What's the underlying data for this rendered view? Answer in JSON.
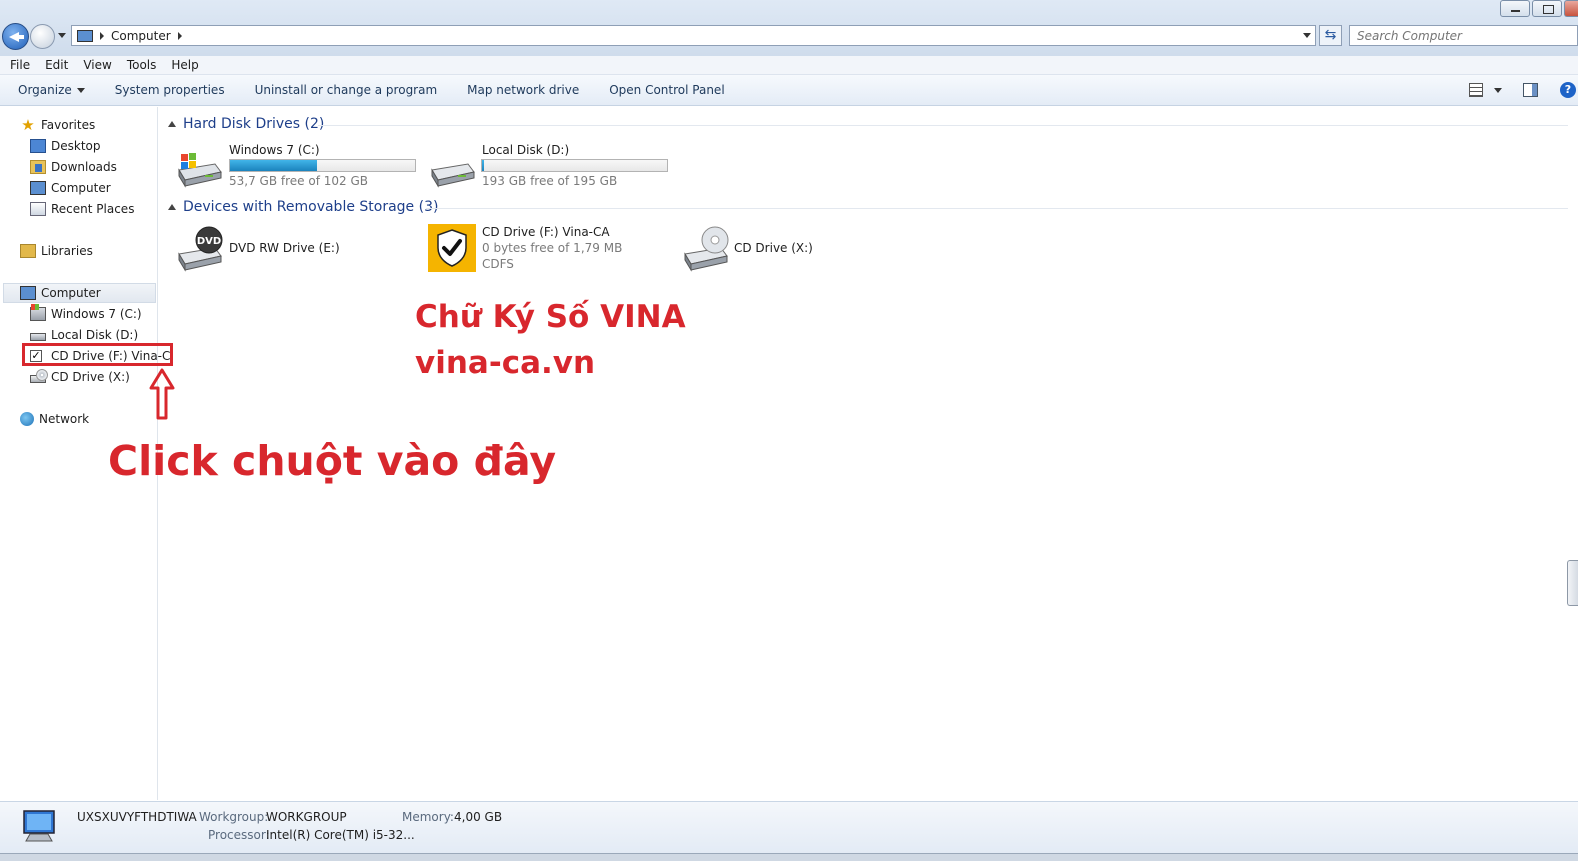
{
  "address": {
    "crumb": "Computer",
    "search_placeholder": "Search Computer"
  },
  "menu": [
    "File",
    "Edit",
    "View",
    "Tools",
    "Help"
  ],
  "commands": {
    "organize": "Organize",
    "system_properties": "System properties",
    "uninstall": "Uninstall or change a program",
    "map_drive": "Map network drive",
    "control_panel": "Open Control Panel"
  },
  "nav": {
    "favorites": "Favorites",
    "desktop": "Desktop",
    "downloads": "Downloads",
    "computer_fav": "Computer",
    "recent": "Recent Places",
    "libraries": "Libraries",
    "computer": "Computer",
    "win_c": "Windows 7 (C:)",
    "local_d": "Local Disk (D:)",
    "cd_f": "CD Drive (F:) Vina-C",
    "cd_x": "CD Drive (X:)",
    "network": "Network"
  },
  "groups": {
    "hdd": "Hard Disk Drives (2)",
    "removable": "Devices with Removable Storage (3)"
  },
  "drives": {
    "c": {
      "name": "Windows 7 (C:)",
      "free": "53,7 GB free of 102 GB",
      "used_fraction": 0.47
    },
    "d": {
      "name": "Local Disk (D:)",
      "free": "193 GB free of 195 GB",
      "used_fraction": 0.01
    },
    "e": {
      "name": "DVD RW Drive (E:)"
    },
    "f": {
      "name": "CD Drive (F:) Vina-CA",
      "free": "0 bytes free of 1,79 MB",
      "fs": "CDFS"
    },
    "x": {
      "name": "CD Drive (X:)"
    }
  },
  "overlay": {
    "brand": "Chữ Ký Số VINA",
    "site": "vina-ca.vn",
    "instruction": "Click chuột vào đây"
  },
  "details": {
    "computer_name": "UXSXUVYFTHDTIWA",
    "workgroup_label": "Workgroup:",
    "workgroup": "WORKGROUP",
    "memory_label": "Memory:",
    "memory": "4,00 GB",
    "processor_label": "Processor:",
    "processor": "Intel(R) Core(TM) i5-32..."
  },
  "colors": {
    "annotation_red": "#d8272d",
    "group_blue": "#1e3f8a",
    "usage_fill": "#26a0da",
    "shield_yellow": "#f5b400"
  }
}
